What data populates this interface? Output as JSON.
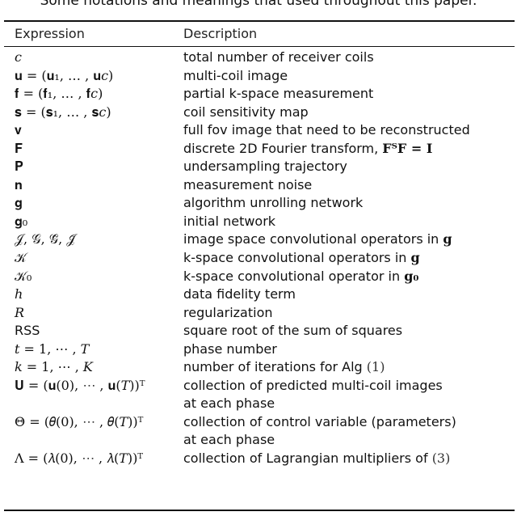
{
  "caption": "Some notations and meanings that used throughout this paper.",
  "headers": {
    "expression": "Expression",
    "description": "Description"
  },
  "rows": [
    {
      "expression": "𝑐",
      "description": "total number of receiver coils"
    },
    {
      "expression": "𝐮 = (𝐮₁, … , 𝐮𝑐)",
      "description": "multi-coil image"
    },
    {
      "expression": "𝐟 = (𝐟₁, … , 𝐟𝑐)",
      "description": "partial k-space measurement"
    },
    {
      "expression": "𝐬 = (𝐬₁, … , 𝐬𝑐)",
      "description": "coil sensitivity map"
    },
    {
      "expression": "𝐯",
      "description": "full fov image that need to be reconstructed"
    },
    {
      "expression": "𝐅",
      "description": "discrete 2D Fourier transform, ",
      "description_math": "𝐅ᵀ𝐅 = 𝐈"
    },
    {
      "expression": "𝐏",
      "description": "undersampling trajectory"
    },
    {
      "expression": "𝐧",
      "description": "measurement noise"
    },
    {
      "expression": "𝐠",
      "description": "algorithm unrolling network"
    },
    {
      "expression": "𝐠₀",
      "description": "initial network"
    },
    {
      "expression": "𝒥, 𝒢, 𝒢̃, 𝒥̃",
      "description": "image space convolutional operators in ",
      "description_math": "𝐠"
    },
    {
      "expression": "𝒦",
      "description": "k-space convolutional operators in ",
      "description_math": "𝐠"
    },
    {
      "expression": "𝒦₀",
      "description": "k-space convolutional operator in ",
      "description_math": "𝐠₀"
    },
    {
      "expression": "ℎ",
      "description": "data fidelity term"
    },
    {
      "expression": "𝑅",
      "description": "regularization"
    },
    {
      "expression": "RSS",
      "description": "square root of the sum of squares",
      "sans": true
    },
    {
      "expression": "𝑡 = 1, ⋯ , 𝑇",
      "description": "phase number"
    },
    {
      "expression": "𝑘 = 1, ⋯ , 𝐾",
      "description": "number of iterations for Alg ",
      "description_ref": "(1)"
    },
    {
      "expression": "𝐔 = (𝐮(0), ⋯ , 𝐮(𝑇))ᵀ",
      "description": "collection of predicted multi-coil images"
    },
    {
      "expression": "",
      "description": "at each phase"
    },
    {
      "expression": "Θ = (𝜃(0), ⋯ , 𝜃(𝑇))ᵀ",
      "description": "collection of control variable (parameters)"
    },
    {
      "expression": "",
      "description": "at each phase"
    },
    {
      "expression": "Λ = (𝜆(0), ⋯ , 𝜆(𝑇))ᵀ",
      "description": "collection of Lagrangian multipliers of ",
      "description_ref": "(3)"
    }
  ]
}
